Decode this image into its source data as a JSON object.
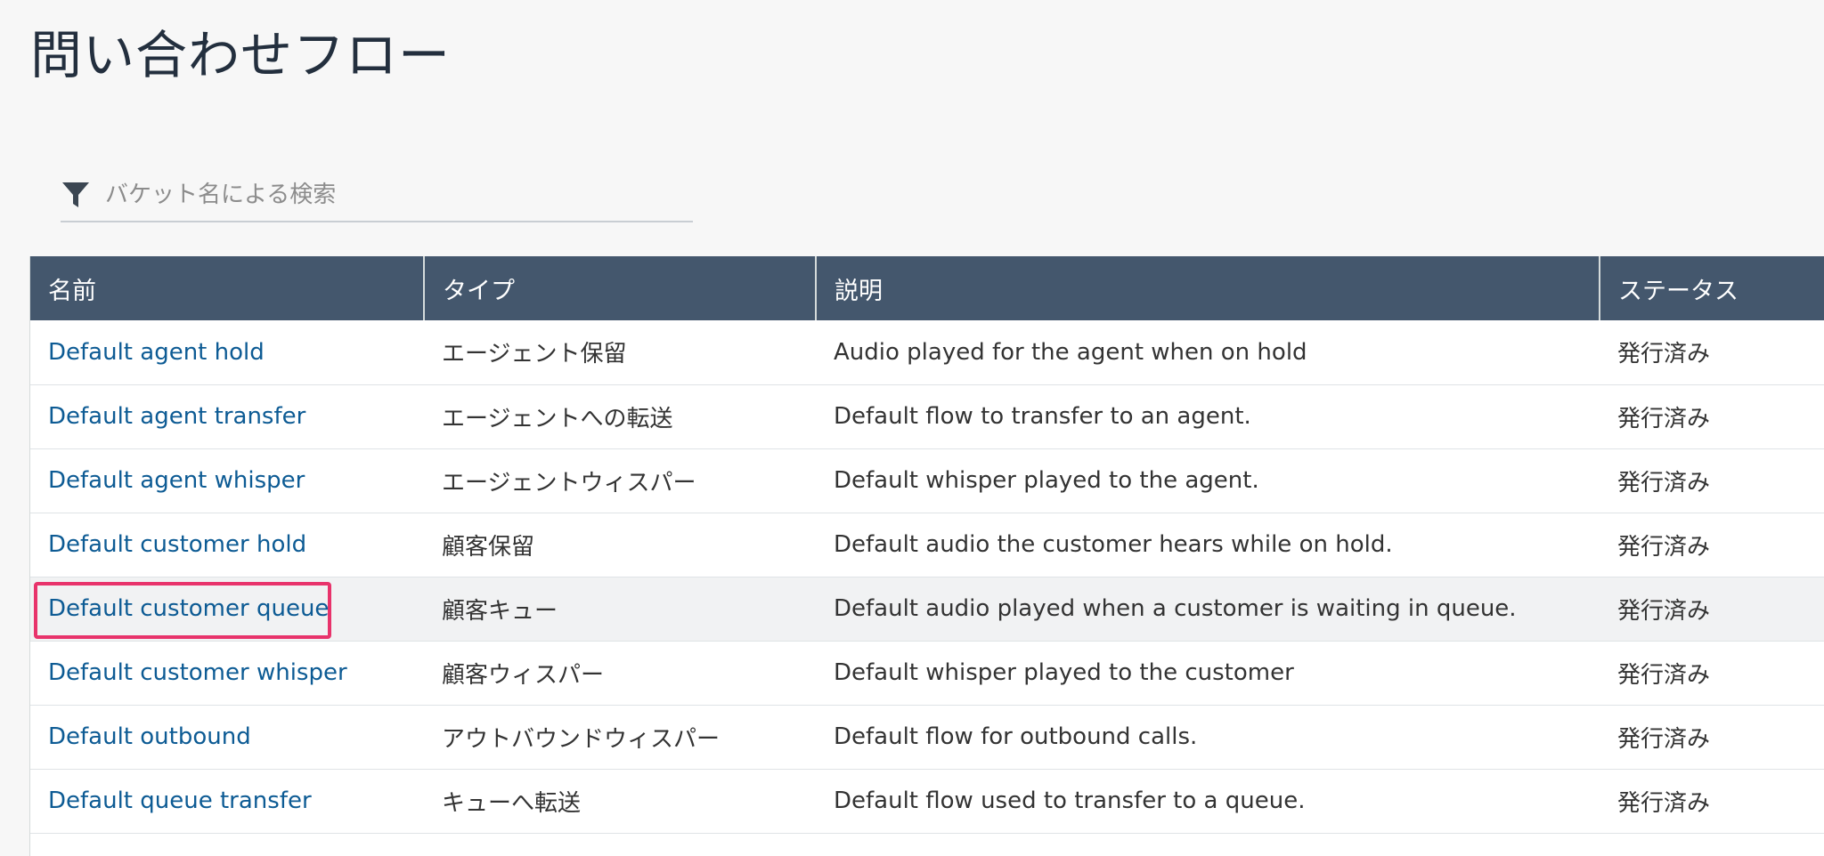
{
  "page": {
    "title": "問い合わせフロー"
  },
  "search": {
    "placeholder": "バケット名による検索"
  },
  "table": {
    "columns": [
      "名前",
      "タイプ",
      "説明",
      "ステータス"
    ],
    "rows": [
      {
        "name": "Default agent hold",
        "type": "エージェント保留",
        "description": "Audio played for the agent when on hold",
        "status": "発行済み"
      },
      {
        "name": "Default agent transfer",
        "type": "エージェントへの転送",
        "description": "Default flow to transfer to an agent.",
        "status": "発行済み"
      },
      {
        "name": "Default agent whisper",
        "type": "エージェントウィスパー",
        "description": "Default whisper played to the agent.",
        "status": "発行済み"
      },
      {
        "name": "Default customer hold",
        "type": "顧客保留",
        "description": "Default audio the customer hears while on hold.",
        "status": "発行済み"
      },
      {
        "name": "Default customer queue",
        "type": "顧客キュー",
        "description": "Default audio played when a customer is waiting in queue.",
        "status": "発行済み"
      },
      {
        "name": "Default customer whisper",
        "type": "顧客ウィスパー",
        "description": "Default whisper played to the customer",
        "status": "発行済み"
      },
      {
        "name": "Default outbound",
        "type": "アウトバウンドウィスパー",
        "description": "Default flow for outbound calls.",
        "status": "発行済み"
      },
      {
        "name": "Default queue transfer",
        "type": "キューへ転送",
        "description": "Default flow used to transfer to a queue.",
        "status": "発行済み"
      }
    ],
    "highlighted_row": 4
  },
  "icons": {
    "filter": "filter-funnel-icon"
  },
  "colors": {
    "header_bg": "#44576d",
    "link": "#0d5b94",
    "highlight_border": "#e8336b"
  }
}
